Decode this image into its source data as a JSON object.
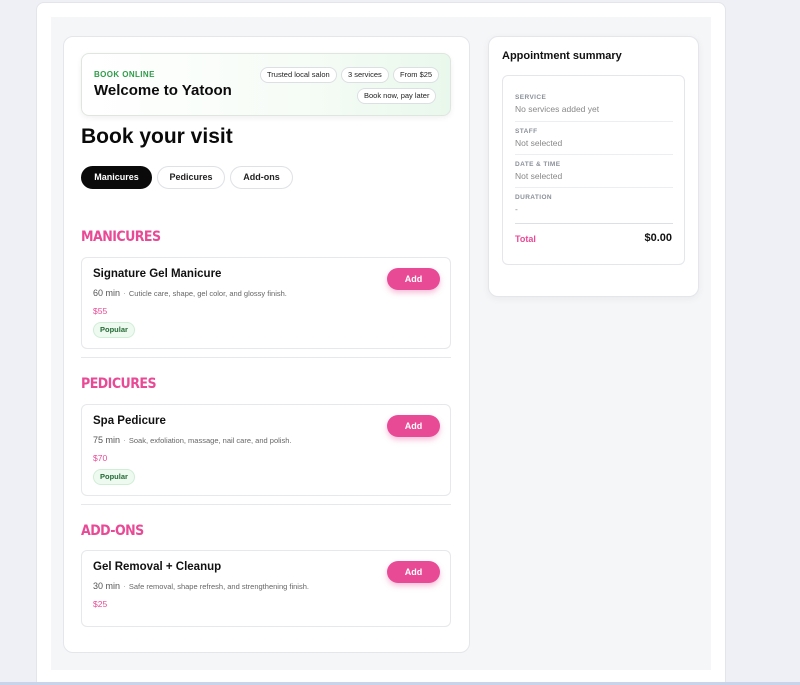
{
  "hero": {
    "eyebrow": "BOOK ONLINE",
    "title": "Welcome to Yatoon",
    "pills": [
      "Trusted local salon",
      "3 services",
      "From $25",
      "Book now, pay later"
    ]
  },
  "page_title": "Book your visit",
  "tabs": [
    {
      "label": "Manicures",
      "active": true
    },
    {
      "label": "Pedicures",
      "active": false
    },
    {
      "label": "Add-ons",
      "active": false
    }
  ],
  "sections": [
    {
      "heading": "MANICURES",
      "service": {
        "name": "Signature Gel Manicure",
        "duration": "60 min",
        "desc": "Cuticle care, shape, gel color, and glossy finish.",
        "price": "$55",
        "badge": "Popular",
        "add_label": "Add"
      }
    },
    {
      "heading": "PEDICURES",
      "service": {
        "name": "Spa Pedicure",
        "duration": "75 min",
        "desc": "Soak, exfoliation, massage, nail care, and polish.",
        "price": "$70",
        "badge": "Popular",
        "add_label": "Add"
      }
    },
    {
      "heading": "ADD-ONS",
      "service": {
        "name": "Gel Removal + Cleanup",
        "duration": "30 min",
        "desc": "Safe removal, shape refresh, and strengthening finish.",
        "price": "$25",
        "badge": "",
        "add_label": "Add"
      }
    }
  ],
  "summary": {
    "title": "Appointment summary",
    "rows": [
      {
        "label": "SERVICE",
        "value": "No services added yet"
      },
      {
        "label": "STAFF",
        "value": "Not selected"
      },
      {
        "label": "DATE & TIME",
        "value": "Not selected"
      },
      {
        "label": "DURATION",
        "value": "-"
      }
    ],
    "total_label": "Total",
    "total_value": "$0.00"
  },
  "colors": {
    "accent": "#e94a96",
    "eyebrow_green": "#2e9c48",
    "tab_active": "#0a0a0a"
  }
}
